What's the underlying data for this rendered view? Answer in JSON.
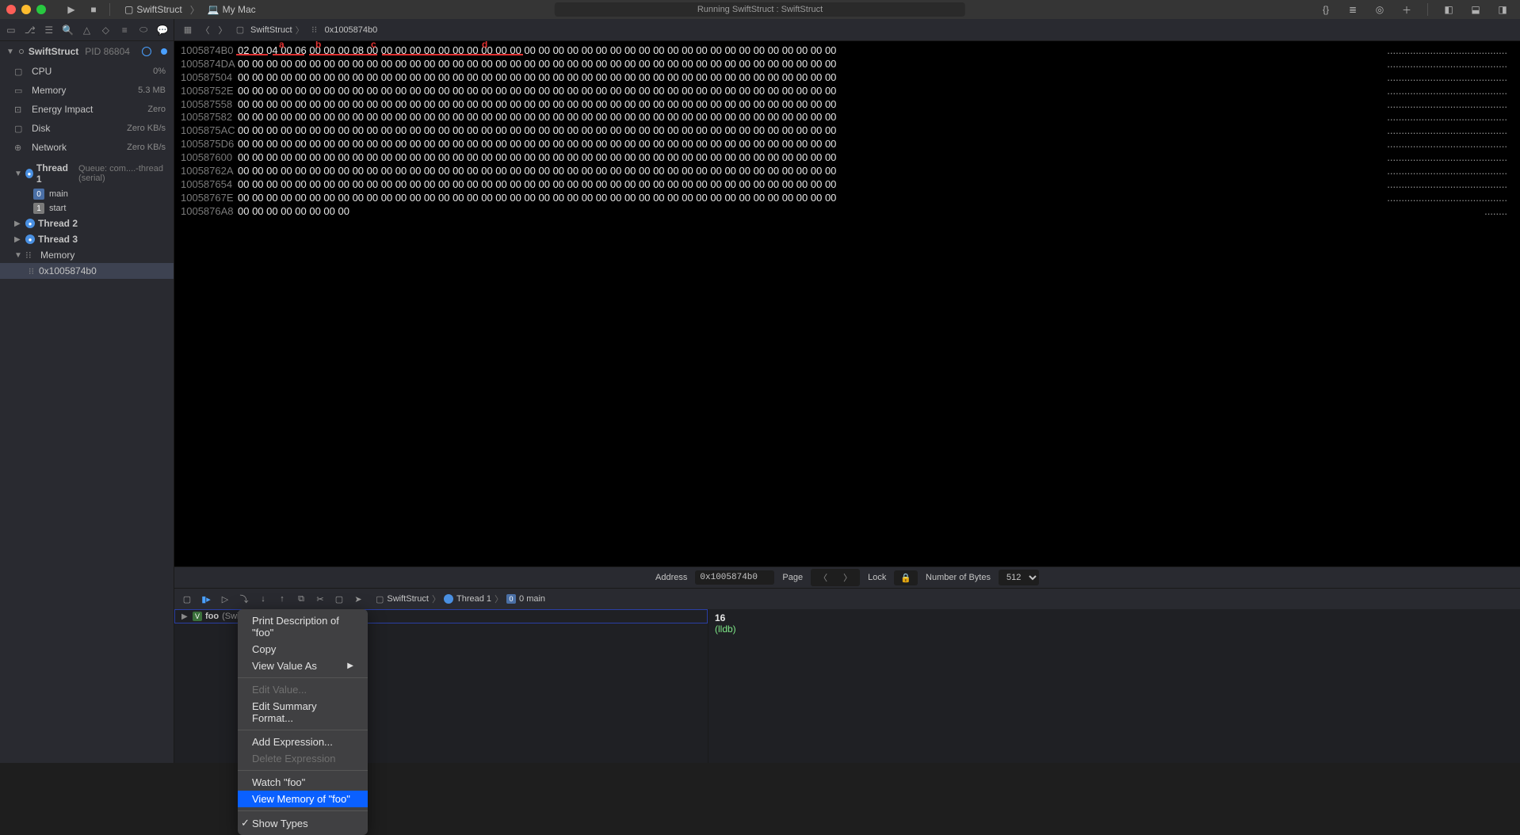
{
  "toolbar": {
    "scheme_project": "SwiftStruct",
    "scheme_destination": "My Mac",
    "status": "Running SwiftStruct : SwiftStruct"
  },
  "sidebar": {
    "process": {
      "name": "SwiftStruct",
      "pid": "PID 86804"
    },
    "metrics": [
      {
        "label": "CPU",
        "value": "0%"
      },
      {
        "label": "Memory",
        "value": "5.3 MB"
      },
      {
        "label": "Energy Impact",
        "value": "Zero"
      },
      {
        "label": "Disk",
        "value": "Zero KB/s"
      },
      {
        "label": "Network",
        "value": "Zero KB/s"
      }
    ],
    "threads": [
      {
        "name": "Thread 1",
        "queue": "Queue: com....-thread (serial)",
        "expanded": true,
        "frames": [
          {
            "num": "0",
            "label": "main"
          },
          {
            "num": "1",
            "label": "start"
          }
        ]
      },
      {
        "name": "Thread 2",
        "expanded": false
      },
      {
        "name": "Thread 3",
        "expanded": false
      }
    ],
    "memory_section": "Memory",
    "memory_leaf": "0x1005874b0"
  },
  "breadcrumb": {
    "project": "SwiftStruct",
    "address": "0x1005874b0"
  },
  "annotations": [
    "a",
    "b",
    "c",
    "d"
  ],
  "hex": {
    "addresses": [
      "1005874B0",
      "1005874DA",
      "100587504",
      "10058752E",
      "100587558",
      "100587582",
      "1005875AC",
      "1005875D6",
      "100587600",
      "10058762A",
      "100587654",
      "10058767E",
      "1005876A8"
    ],
    "first_row_bytes": "02 00 04 00 06 00 00 00 08 00 00 00 00 00 00 00 00 00 00 00 00 00 00 00 00 00 00 00 00 00 00 00 00 00 00 00 00 00 00 00 00 00",
    "zero_row_bytes": "00 00 00 00 00 00 00 00 00 00 00 00 00 00 00 00 00 00 00 00 00 00 00 00 00 00 00 00 00 00 00 00 00 00 00 00 00 00 00 00 00 00",
    "last_row_bytes": "00 00 00 00 00 00 00 00",
    "ascii_full": "..........................................",
    "ascii_last": "........"
  },
  "mem_controls": {
    "address_label": "Address",
    "address_value": "0x1005874b0",
    "page_label": "Page",
    "lock_label": "Lock",
    "num_bytes_label": "Number of Bytes",
    "num_bytes_value": "512"
  },
  "debug_breadcrumb": {
    "project": "SwiftStruct",
    "thread": "Thread 1",
    "frame": "0 main"
  },
  "variable": {
    "name": "foo",
    "type": "(SwiftSt..."
  },
  "console": {
    "output": "16",
    "prompt": "(lldb)"
  },
  "context_menu": {
    "items": [
      {
        "label": "Print Description of \"foo\""
      },
      {
        "label": "Copy"
      },
      {
        "label": "View Value As",
        "submenu": true
      },
      {
        "sep": true
      },
      {
        "label": "Edit Value...",
        "disabled": true
      },
      {
        "label": "Edit Summary Format..."
      },
      {
        "sep": true
      },
      {
        "label": "Add Expression..."
      },
      {
        "label": "Delete Expression",
        "disabled": true
      },
      {
        "sep": true
      },
      {
        "label": "Watch \"foo\""
      },
      {
        "label": "View Memory of \"foo\"",
        "selected": true
      },
      {
        "sep": true
      },
      {
        "label": "Show Types",
        "checked": true
      }
    ]
  }
}
